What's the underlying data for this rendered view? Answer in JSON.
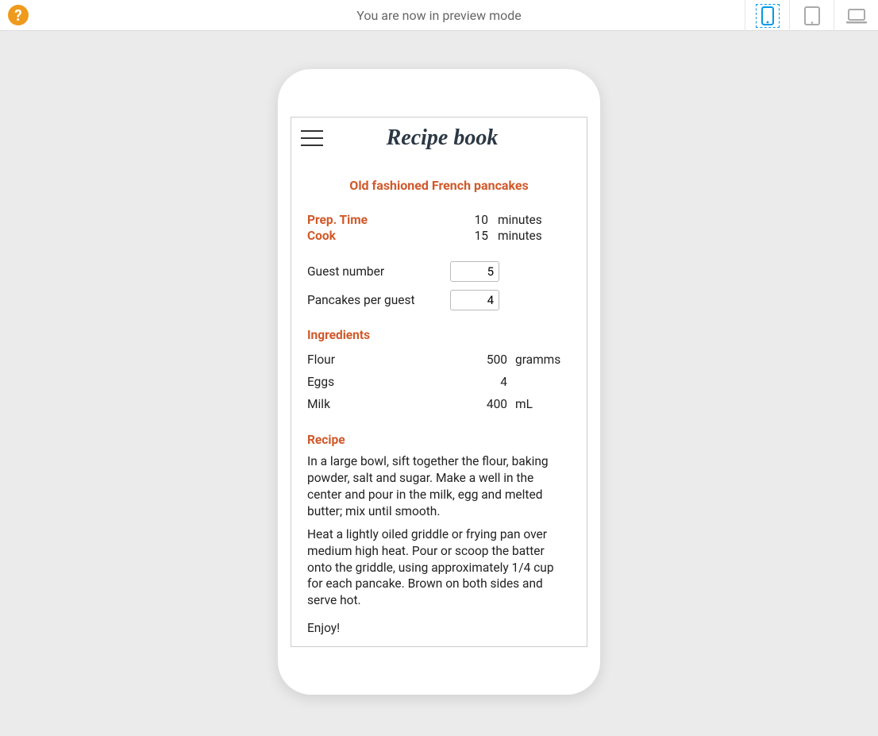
{
  "topbar": {
    "help_glyph": "?",
    "title": "You are now in preview mode"
  },
  "app": {
    "title": "Recipe book",
    "recipe_title": "Old fashioned French pancakes",
    "meta": {
      "prep_label": "Prep. Time",
      "prep_value": "10",
      "prep_unit": "minutes",
      "cook_label": "Cook",
      "cook_value": "15",
      "cook_unit": "minutes"
    },
    "inputs": {
      "guest_label": "Guest number",
      "guest_value": "5",
      "per_guest_label": "Pancakes per guest",
      "per_guest_value": "4"
    },
    "ingredients_heading": "Ingredients",
    "ingredients": [
      {
        "name": "Flour",
        "qty": "500",
        "unit": "gramms"
      },
      {
        "name": "Eggs",
        "qty": "4",
        "unit": ""
      },
      {
        "name": "Milk",
        "qty": "400",
        "unit": "mL"
      }
    ],
    "recipe_heading": "Recipe",
    "recipe_steps": [
      "In a large bowl, sift together the flour, baking powder, salt and sugar. Make a well in the center and pour in the milk, egg and melted butter; mix until smooth.",
      "Heat a lightly oiled griddle or frying pan over medium high heat. Pour or scoop the batter onto the griddle, using approximately 1/4 cup for each pancake. Brown on both sides and serve hot."
    ],
    "enjoy": "Enjoy!"
  }
}
